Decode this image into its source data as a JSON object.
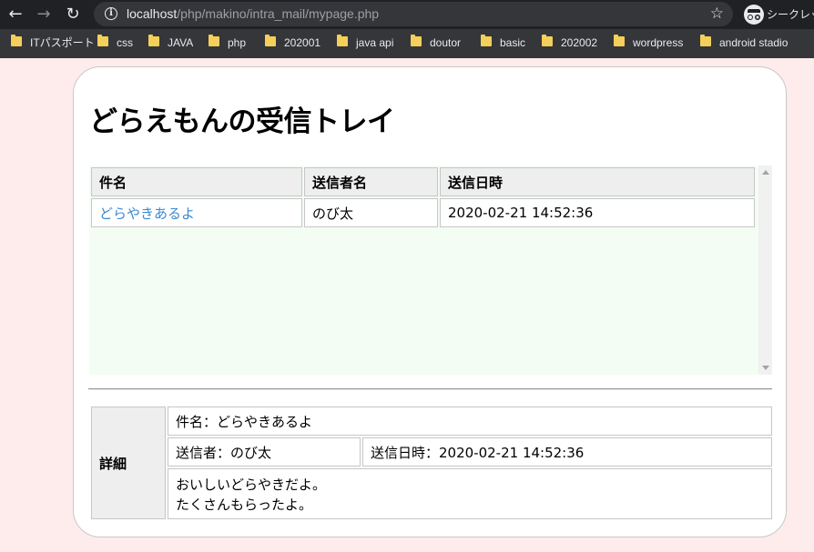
{
  "browser": {
    "url_host": "localhost",
    "url_path": "/php/makino/intra_mail/mypage.php",
    "profile_label": "シークレット",
    "bookmarks": [
      "ITパスポート",
      "css",
      "JAVA",
      "php",
      "202001",
      "java api",
      "doutor",
      "basic",
      "202002",
      "wordpress",
      "android stadio"
    ]
  },
  "page": {
    "title": "どらえもんの受信トレイ"
  },
  "inbox": {
    "headers": [
      "件名",
      "送信者名",
      "送信日時"
    ],
    "rows": [
      {
        "subject": "どらやきあるよ",
        "sender": "のび太",
        "sent_at": "2020-02-21 14:52:36"
      }
    ]
  },
  "detail": {
    "header": "詳細",
    "subject": "件名：どらやきあるよ",
    "sender": "送信者：のび太",
    "sent_at": "送信日時：2020-02-21 14:52:36",
    "body_lines": [
      "おいしいどらやきだよ。",
      "たくさんもらったよ。"
    ]
  },
  "colors": {
    "page_background": "#fdeceb",
    "inbox_background": "#f3fdf4",
    "link": "#3c89d0",
    "header_cell": "#eeeeee"
  },
  "icons": [
    "back-icon",
    "forward-icon",
    "reload-icon",
    "info-icon",
    "star-icon",
    "incognito-icon",
    "folder-icon"
  ]
}
